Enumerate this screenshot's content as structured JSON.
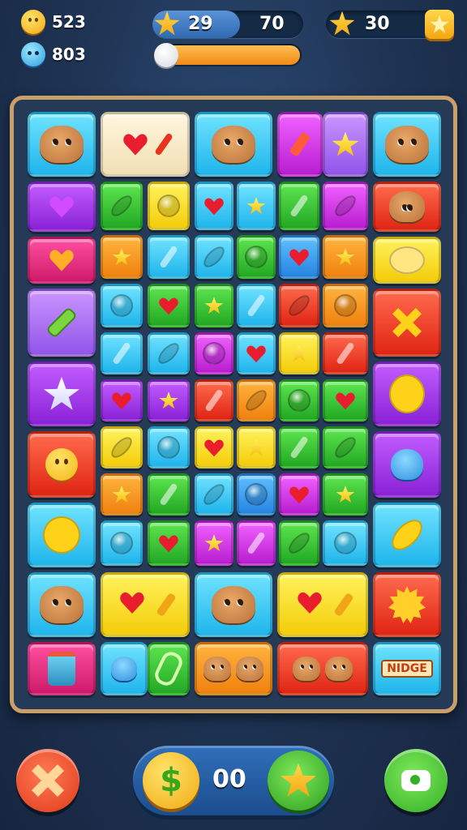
{
  "hud": {
    "coins": "523",
    "gems": "803",
    "level_current": "29",
    "level_target": "70",
    "stars": "30",
    "level_progress": 0.58,
    "energy_progress": 0.97
  },
  "board": {
    "frame_color": "#c9a06a",
    "tiles": [
      {
        "color": "c-cyan",
        "icon": "critter"
      },
      {
        "color": "c-cream",
        "icon": "heart"
      },
      {
        "color": "c-cyan",
        "icon": "critter"
      },
      {
        "color": "c-magenta",
        "icon": "leaf"
      },
      {
        "color": "c-lav",
        "icon": "star"
      },
      {
        "color": "c-cyan",
        "icon": "critter"
      },
      {
        "color": "c-purple",
        "icon": "heart"
      },
      {
        "color": "c-red",
        "icon": "critter"
      },
      {
        "color": "c-pink",
        "icon": "heart"
      },
      {
        "color": "c-lav",
        "icon": "bone"
      },
      {
        "color": "c-red",
        "icon": "cross"
      },
      {
        "color": "c-purple",
        "icon": "star"
      },
      {
        "color": "c-yellow",
        "icon": "orb"
      },
      {
        "color": "c-red",
        "icon": "face"
      },
      {
        "color": "c-purple",
        "icon": "blob"
      },
      {
        "color": "c-cyan",
        "icon": "orb"
      },
      {
        "color": "c-cyan",
        "icon": "leaf"
      },
      {
        "color": "c-cyan",
        "icon": "critter"
      },
      {
        "color": "c-yellow",
        "icon": "heart"
      },
      {
        "color": "c-cyan",
        "icon": "critter"
      },
      {
        "color": "c-yellow",
        "icon": "heart"
      },
      {
        "color": "c-red",
        "icon": "sun"
      },
      {
        "color": "c-pink",
        "icon": "mug"
      },
      {
        "color": "c-cyan",
        "icon": "blob"
      },
      {
        "color": "c-green",
        "icon": "pickle"
      },
      {
        "color": "c-orange",
        "icon": "critter-pair"
      },
      {
        "color": "c-red",
        "icon": "critter-pair"
      },
      {
        "color": "c-cyan",
        "icon": "badge",
        "label": "NIDGE"
      }
    ],
    "small_tiles": [
      [
        "c-green",
        "c-yellow",
        "c-cyan",
        "c-cyan",
        "c-green",
        "c-magenta"
      ],
      [
        "c-orange",
        "c-cyan",
        "c-cyan",
        "c-green",
        "c-blue",
        "c-orange"
      ],
      [
        "c-cyan",
        "c-green",
        "c-green",
        "c-cyan",
        "c-red",
        "c-orange"
      ],
      [
        "c-cyan",
        "c-cyan",
        "c-magenta",
        "c-cyan",
        "c-yellow",
        "c-red"
      ],
      [
        "c-purple",
        "c-purple",
        "c-red",
        "c-orange",
        "c-green",
        "c-green"
      ],
      [
        "c-yellow",
        "c-cyan",
        "c-yellow",
        "c-yellow",
        "c-green",
        "c-green"
      ],
      [
        "c-orange",
        "c-green",
        "c-cyan",
        "c-blue",
        "c-magenta",
        "c-green"
      ],
      [
        "c-cyan",
        "c-green",
        "c-magenta",
        "c-magenta",
        "c-green",
        "c-cyan"
      ]
    ]
  },
  "bottom": {
    "counter": "00"
  }
}
